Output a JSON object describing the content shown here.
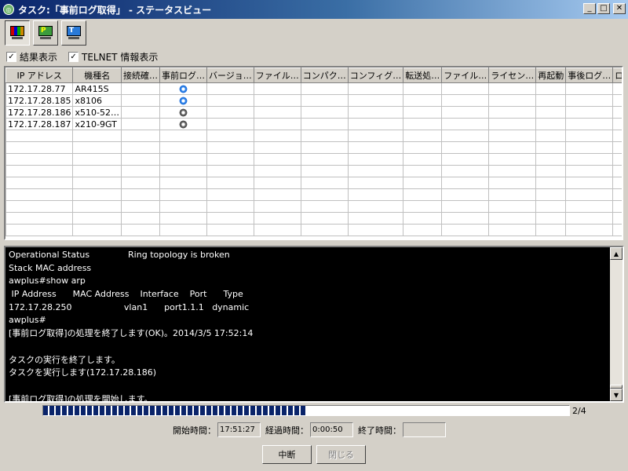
{
  "window": {
    "title": "タスク:「事前ログ取得」 - ステータスビュー"
  },
  "toolbar": [
    {
      "icon": "log-view-icon",
      "letter": "",
      "pressed": true
    },
    {
      "icon": "p-icon",
      "letter": "P",
      "pressed": false
    },
    {
      "icon": "t-icon",
      "letter": "T",
      "pressed": false
    }
  ],
  "options": {
    "show_results": {
      "label": "結果表示",
      "checked": true
    },
    "show_telnet": {
      "label": "TELNET 情報表示",
      "checked": true
    }
  },
  "grid": {
    "columns": [
      "IP アドレス",
      "機種名",
      "接続確…",
      "事前ログ…",
      "バージョ…",
      "ファイル…",
      "コンパク…",
      "コンフィグ…",
      "転送処…",
      "ファイル…",
      "ライセン…",
      "再起動",
      "事後ログ…",
      "ログ比較"
    ],
    "rows": [
      {
        "ip": "172.17.28.77",
        "model": "AR415S",
        "prelog": "active"
      },
      {
        "ip": "172.17.28.185",
        "model": "x8106",
        "prelog": "active"
      },
      {
        "ip": "172.17.28.186",
        "model": "x510-52…",
        "prelog": "waiting"
      },
      {
        "ip": "172.17.28.187",
        "model": "x210-9GT",
        "prelog": "waiting"
      }
    ]
  },
  "console": {
    "lines": [
      "Operational Status              Ring topology is broken",
      "Stack MAC address",
      "awplus#show arp",
      " IP Address      MAC Address    Interface    Port      Type",
      "172.17.28.250                   vlan1      port1.1.1   dynamic",
      "awplus#",
      "[事前ログ取得]の処理を終了します(OK)。2014/3/5 17:52:14",
      "",
      "タスクの実行を終了します。",
      "タスクを実行します(172.17.28.186)",
      "",
      "[事前ログ取得]の処理を開始します。"
    ]
  },
  "progress": {
    "fraction": 0.5,
    "label": "2/4"
  },
  "times": {
    "start_label": "開始時間：",
    "start_value": "17:51:27",
    "elapsed_label": "経過時間：",
    "elapsed_value": "0:00:50",
    "end_label": "終了時間：",
    "end_value": ""
  },
  "buttons": {
    "abort": "中断",
    "close": "閉じる"
  }
}
